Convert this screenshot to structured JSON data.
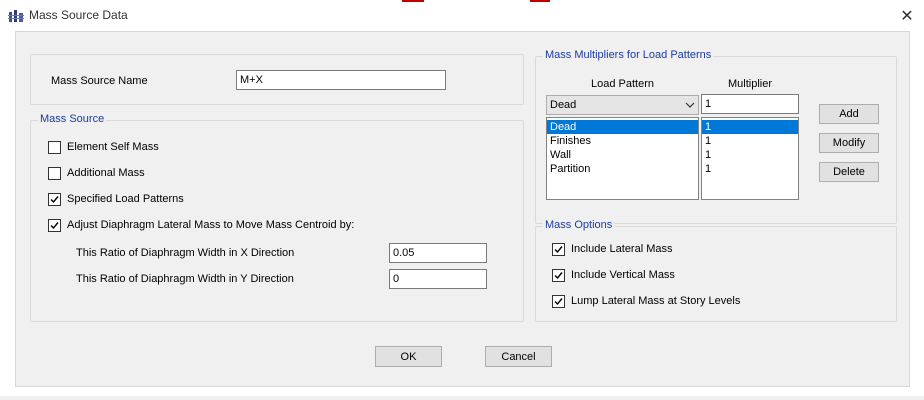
{
  "window": {
    "title": "Mass Source Data",
    "close_glyph": "✕"
  },
  "mass_source_name": {
    "label": "Mass Source Name",
    "value": "M+X"
  },
  "mass_source": {
    "title": "Mass Source",
    "element_self_mass": {
      "label": "Element Self Mass",
      "checked": false
    },
    "additional_mass": {
      "label": "Additional Mass",
      "checked": false
    },
    "specified_load_patterns": {
      "label": "Specified Load Patterns",
      "checked": true
    },
    "adjust_diaphragm": {
      "label": "Adjust Diaphragm Lateral Mass to Move Mass Centroid by:",
      "checked": true
    },
    "x_ratio": {
      "label": "This Ratio of Diaphragm Width in X Direction",
      "value": "0.05"
    },
    "y_ratio": {
      "label": "This Ratio of Diaphragm Width in Y Direction",
      "value": "0"
    }
  },
  "multipliers": {
    "title": "Mass Multipliers for Load Patterns",
    "col_load_pattern": "Load Pattern",
    "col_multiplier": "Multiplier",
    "pattern_selected": "Dead",
    "multiplier_value": "1",
    "rows": [
      {
        "pattern": "Dead",
        "multiplier": "1"
      },
      {
        "pattern": "Finishes",
        "multiplier": "1"
      },
      {
        "pattern": "Wall",
        "multiplier": "1"
      },
      {
        "pattern": "Partition",
        "multiplier": "1"
      }
    ],
    "add_label": "Add",
    "modify_label": "Modify",
    "delete_label": "Delete"
  },
  "mass_options": {
    "title": "Mass Options",
    "include_lateral": {
      "label": "Include Lateral Mass",
      "checked": true
    },
    "include_vertical": {
      "label": "Include Vertical Mass",
      "checked": true
    },
    "lump_lateral": {
      "label": "Lump Lateral Mass at Story Levels",
      "checked": true
    }
  },
  "footer": {
    "ok_label": "OK",
    "cancel_label": "Cancel"
  },
  "colors": {
    "group_title": "#1c3aa0",
    "selection": "#0078d7",
    "accent_red": "#c00000"
  },
  "icons": {
    "app": "building-frame-icon",
    "close": "close-icon",
    "dropdown": "chevron-down-icon",
    "check": "checkmark-icon"
  }
}
